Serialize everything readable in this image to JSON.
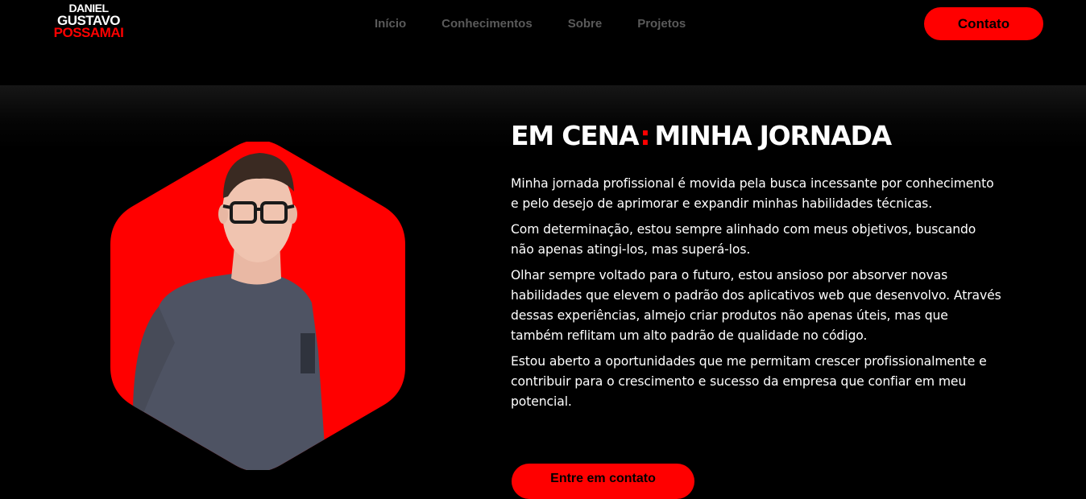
{
  "logo": {
    "line1": "DANIEL",
    "line2": "GUSTAVO",
    "line3": "POSSAMAI",
    "accent_color": "#ff0000"
  },
  "nav": {
    "items": [
      {
        "label": "Início"
      },
      {
        "label": "Conhecimentos"
      },
      {
        "label": "Sobre"
      },
      {
        "label": "Projetos"
      }
    ]
  },
  "header": {
    "contact_label": "Contato"
  },
  "about": {
    "title_part1": "EM CENA",
    "title_colon": ":",
    "title_part2": "MINHA JORNADA",
    "paragraphs": [
      "Minha jornada profissional é movida pela busca incessante por conhecimento e pelo desejo de aprimorar e expandir minhas habilidades técnicas.",
      "Com determinação, estou sempre alinhado com meus objetivos, buscando não apenas atingi-los, mas superá-los.",
      "Olhar sempre voltado para o futuro, estou ansioso por absorver novas habilidades que elevem o padrão dos aplicativos web que desenvolvo. Através dessas experiências, almejo criar produtos não apenas úteis, mas que também reflitam um alto padrão de qualidade no código.",
      "Estou aberto a oportunidades que me permitam crescer profissionalmente e contribuir para o crescimento e sucesso da empresa que confiar em meu potencial."
    ],
    "cta_label": "Entre em contato",
    "photo_background_color": "#ff0000"
  }
}
